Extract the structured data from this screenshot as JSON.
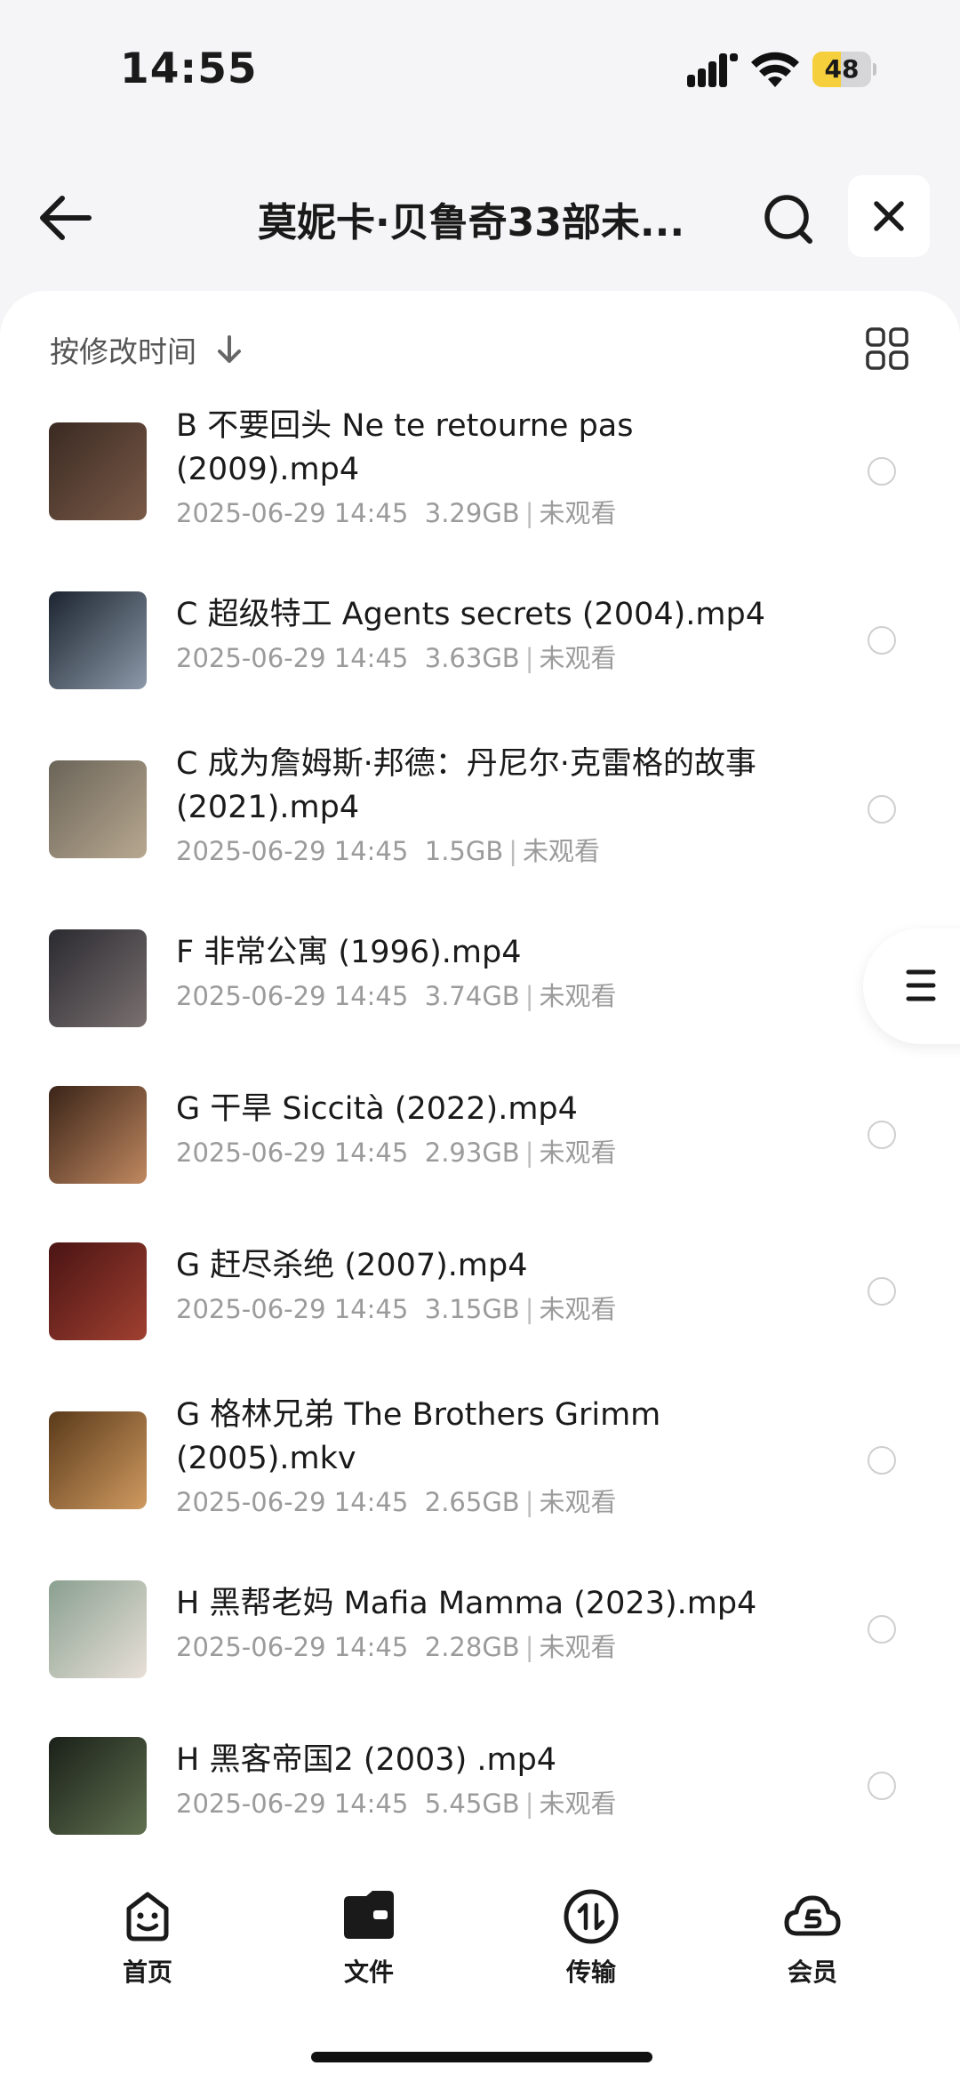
{
  "status_bar": {
    "time": "14:55",
    "battery": "48",
    "battery_level": 0.48
  },
  "header": {
    "title": "莫妮卡·贝鲁奇33部未..."
  },
  "sort": {
    "label": "按修改时间"
  },
  "files": [
    {
      "name": "B 不要回头 Ne te retourne pas (2009).mp4",
      "date": "2025-06-29 14:45",
      "size": "3.29GB",
      "status": "未观看",
      "thumb": [
        "#3a2a22",
        "#7a5a48"
      ]
    },
    {
      "name": "C 超级特工 Agents secrets (2004).mp4",
      "date": "2025-06-29 14:45",
      "size": "3.63GB",
      "status": "未观看",
      "thumb": [
        "#1c2430",
        "#8c99a8"
      ]
    },
    {
      "name": "C 成为詹姆斯·邦德：丹尼尔·克雷格的故事 (2021).mp4",
      "date": "2025-06-29 14:45",
      "size": "1.5GB",
      "status": "未观看",
      "thumb": [
        "#6a6458",
        "#b8a890"
      ]
    },
    {
      "name": "F 非常公寓 (1996).mp4",
      "date": "2025-06-29 14:45",
      "size": "3.74GB",
      "status": "未观看",
      "thumb": [
        "#2a2a30",
        "#7a7070"
      ]
    },
    {
      "name": "G 干旱 Siccità (2022).mp4",
      "date": "2025-06-29 14:45",
      "size": "2.93GB",
      "status": "未观看",
      "thumb": [
        "#3a2418",
        "#c08860"
      ]
    },
    {
      "name": "G 赶尽杀绝 (2007).mp4",
      "date": "2025-06-29 14:45",
      "size": "3.15GB",
      "status": "未观看",
      "thumb": [
        "#4a1414",
        "#a04030"
      ]
    },
    {
      "name": "G 格林兄弟 The Brothers Grimm (2005).mkv",
      "date": "2025-06-29 14:45",
      "size": "2.65GB",
      "status": "未观看",
      "thumb": [
        "#5a3a1a",
        "#d09a60"
      ]
    },
    {
      "name": "H 黑帮老妈 Mafia Mamma (2023).mp4",
      "date": "2025-06-29 14:45",
      "size": "2.28GB",
      "status": "未观看",
      "thumb": [
        "#8aa090",
        "#e8e0d8"
      ]
    },
    {
      "name": "H 黑客帝国2 (2003) .mp4",
      "date": "2025-06-29 14:45",
      "size": "5.45GB",
      "status": "未观看",
      "thumb": [
        "#1a2018",
        "#607050"
      ]
    }
  ],
  "nav": [
    {
      "label": "首页",
      "icon": "smiley-home-icon"
    },
    {
      "label": "文件",
      "icon": "folder-icon"
    },
    {
      "label": "传输",
      "icon": "transfer-icon"
    },
    {
      "label": "会员",
      "icon": "cloud-vip-icon"
    }
  ]
}
